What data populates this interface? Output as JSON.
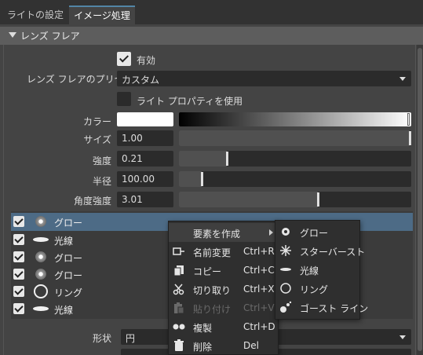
{
  "tabs": [
    {
      "label": "ライトの設定",
      "active": false
    },
    {
      "label": "イメージ処理",
      "active": true
    }
  ],
  "section": {
    "title": "レンズ フレア",
    "expanded": true
  },
  "enabled": {
    "label": "有効",
    "checked": true
  },
  "preset": {
    "label": "レンズ フレアのプリセット",
    "value": "カスタム"
  },
  "use_light_props": {
    "label": "ライト プロパティを使用",
    "checked": false
  },
  "color": {
    "label": "カラー",
    "swatch": "#ffffff",
    "gradient_level": 1.0
  },
  "size": {
    "label": "サイズ",
    "value": "1.00",
    "fraction": 1.0
  },
  "intensity": {
    "label": "強度",
    "value": "0.21",
    "fraction": 0.21
  },
  "radius": {
    "label": "半径",
    "value": "100.00",
    "fraction": 0.1
  },
  "angle_strength": {
    "label": "角度強度",
    "value": "3.01",
    "fraction": 0.6
  },
  "elements": [
    {
      "label": "グロー",
      "icon": "glow-icon",
      "checked": true,
      "selected": true
    },
    {
      "label": "光線",
      "icon": "streak-icon",
      "checked": true,
      "selected": false
    },
    {
      "label": "グロー",
      "icon": "glow-icon",
      "checked": true,
      "selected": false
    },
    {
      "label": "グロー",
      "icon": "glow-icon",
      "checked": true,
      "selected": false
    },
    {
      "label": "リング",
      "icon": "ring-icon",
      "checked": true,
      "selected": false
    },
    {
      "label": "光線",
      "icon": "streak-icon",
      "checked": true,
      "selected": false
    }
  ],
  "shape": {
    "label": "形状",
    "value": "円"
  },
  "context_menu": {
    "items": [
      {
        "label": "要素を作成",
        "shortcut": "",
        "icon": "",
        "has_submenu": true,
        "highlighted": true,
        "enabled": true
      },
      {
        "label": "名前変更",
        "shortcut": "Ctrl+R",
        "icon": "rename-icon",
        "enabled": true
      },
      {
        "label": "コピー",
        "shortcut": "Ctrl+C",
        "icon": "copy-icon",
        "enabled": true
      },
      {
        "label": "切り取り",
        "shortcut": "Ctrl+X",
        "icon": "scissors-icon",
        "enabled": true
      },
      {
        "label": "貼り付け",
        "shortcut": "Ctrl+V",
        "icon": "paste-icon",
        "enabled": false
      },
      {
        "label": "複製",
        "shortcut": "Ctrl+D",
        "icon": "duplicate-icon",
        "enabled": true
      },
      {
        "label": "削除",
        "shortcut": "Del",
        "icon": "trash-icon",
        "enabled": true
      }
    ]
  },
  "submenu": {
    "items": [
      {
        "label": "グロー",
        "icon": "glow-icon"
      },
      {
        "label": "スターバースト",
        "icon": "starburst-icon"
      },
      {
        "label": "光線",
        "icon": "streak-icon"
      },
      {
        "label": "リング",
        "icon": "ring-icon"
      },
      {
        "label": "ゴースト ライン",
        "icon": "ghost-line-icon"
      }
    ]
  }
}
